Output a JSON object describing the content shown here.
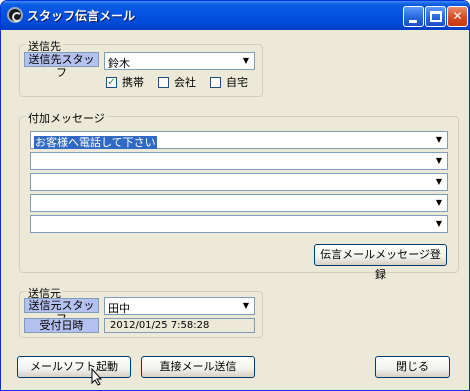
{
  "window": {
    "title": "スタッフ伝言メール",
    "controls": {
      "minimize": "",
      "maximize": "",
      "close": "✕"
    }
  },
  "recipient": {
    "group_label": "送信先",
    "staff_label": "送信先スタッフ",
    "staff_value": "鈴木",
    "checkboxes": [
      {
        "label": "携帯",
        "checked": true,
        "mark": "✓"
      },
      {
        "label": "会社",
        "checked": false,
        "mark": ""
      },
      {
        "label": "自宅",
        "checked": false,
        "mark": ""
      }
    ]
  },
  "messages": {
    "group_label": "付加メッセージ",
    "lines": [
      "お客様へ電話して下さい",
      "",
      "",
      "",
      ""
    ],
    "register_button": "伝言メールメッセージ登録"
  },
  "sender": {
    "group_label": "送信元",
    "staff_label": "送信元スタッフ",
    "staff_value": "田中",
    "date_label": "受付日時",
    "date_value": "2012/01/25 7:58:28"
  },
  "footer": {
    "mail_app_button": "メールソフト起動",
    "direct_send_button": "直接メール送信",
    "close_button": "閉じる"
  },
  "icons": {
    "dropdown": "▼"
  }
}
